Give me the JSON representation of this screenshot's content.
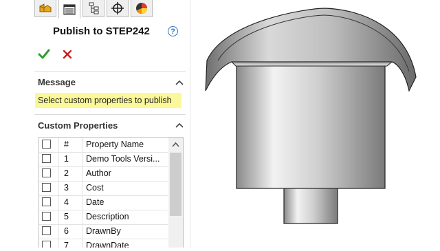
{
  "panel": {
    "tabs": [
      {
        "name": "feature-manager-tab",
        "active": false
      },
      {
        "name": "property-manager-tab",
        "active": true
      },
      {
        "name": "configuration-manager-tab",
        "active": false
      },
      {
        "name": "dimxpert-manager-tab",
        "active": false
      },
      {
        "name": "display-manager-tab",
        "active": false
      }
    ],
    "title": "Publish to STEP242",
    "help_glyph": "?",
    "actions": {
      "ok_icon": "checkmark-icon",
      "cancel_icon": "x-icon"
    },
    "message_section": {
      "title": "Message",
      "text": "Select custom properties to publish",
      "highlight_color": "#fbf89a"
    },
    "custom_properties": {
      "title": "Custom Properties",
      "columns": {
        "checkbox": "",
        "number": "#",
        "name": "Property Name"
      },
      "rows": [
        {
          "num": "1",
          "name": "Demo Tools Versi..."
        },
        {
          "num": "2",
          "name": "Author"
        },
        {
          "num": "3",
          "name": "Cost"
        },
        {
          "num": "4",
          "name": "Date"
        },
        {
          "num": "5",
          "name": "Description"
        },
        {
          "num": "6",
          "name": "DrawnBy"
        },
        {
          "num": "7",
          "name": "DrawnDate"
        }
      ]
    }
  },
  "colors": {
    "ok": "#2e9e2e",
    "cancel": "#c42020",
    "accent": "#2a6fc7"
  }
}
